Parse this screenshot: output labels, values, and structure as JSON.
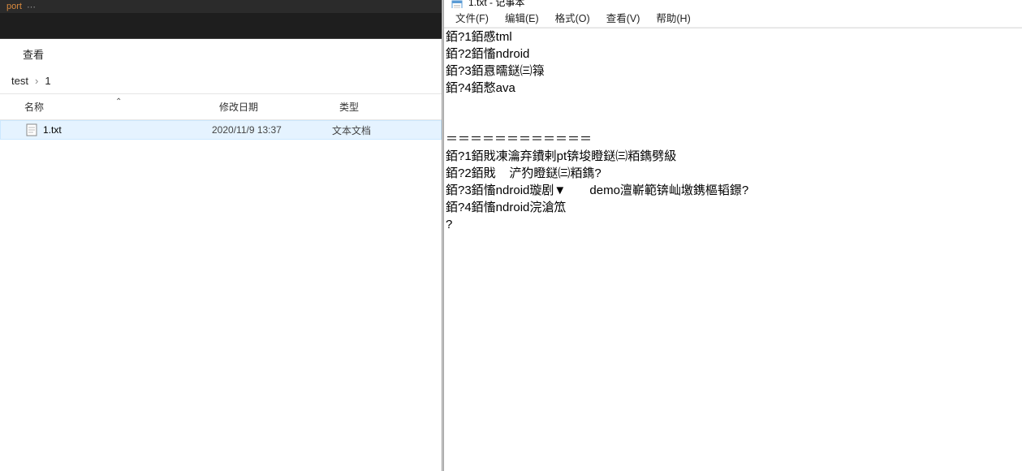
{
  "left": {
    "dark_bar_text": "port",
    "toolbar": {
      "view": "查看"
    },
    "breadcrumb": [
      "test",
      "1"
    ],
    "columns": {
      "name": "名称",
      "date": "修改日期",
      "type": "类型"
    },
    "files": [
      {
        "name": "1.txt",
        "date": "2020/11/9 13:37",
        "type": "文本文档"
      }
    ]
  },
  "notepad": {
    "title": "1.txt - 记事本",
    "menu": {
      "file": "文件(F)",
      "edit": "编辑(E)",
      "format": "格式(O)",
      "view": "查看(V)",
      "help": "帮助(H)"
    },
    "content": "銆?1銆慼tml\n銆?2銆慉ndroid\n銆?3銆慐曘鎹㈢簶\n銆?4銆慗ava\n\n\n＝＝＝＝＝＝＝＝＝＝＝＝\n銆?1銆戝凍瀹弃鐨剌pt锛埈瞪鎹㈢粨鐫劈級\n銆?2銆戝    浐犳瞪鎹㈢粨鐫?\n銆?3銆慉ndroid璇剧▼       demo澶嶄範锛屾墽鎸樞韬鐛?\n銆?4銆慉ndroid浣滄笟\n?"
  }
}
